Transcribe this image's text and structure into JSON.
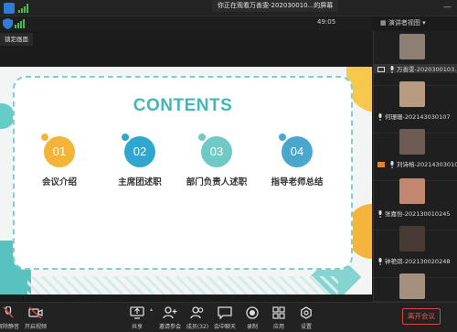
{
  "topbar": {
    "title": "你正在观看万善雯-202030010...的屏幕",
    "minimize": "—"
  },
  "meetbar": {
    "timer": "49:05",
    "view_mode": "演讲者视图"
  },
  "lock_view": "锁定画面",
  "slide": {
    "heading": "CONTENTS",
    "items": [
      {
        "num": "01",
        "label": "会议介绍",
        "color": "#f4b43a"
      },
      {
        "num": "02",
        "label": "主席团述职",
        "color": "#2fa7cf"
      },
      {
        "num": "03",
        "label": "部门负责人述职",
        "color": "#6fcac6"
      },
      {
        "num": "04",
        "label": "指导老师总结",
        "color": "#49a6cc"
      }
    ]
  },
  "participants": [
    {
      "name": "万善雯-2020300103...",
      "photo": "#8d7f73",
      "screen": true
    },
    {
      "name": "何珊珊-202143030107",
      "photo": "#b89c7f",
      "screen": false
    },
    {
      "name": "刘诗榕-20214303010...",
      "photo": "#6e5a55",
      "screen": true
    },
    {
      "name": "张嘉怡-202130010245",
      "photo": "#c1876f",
      "screen": false
    },
    {
      "name": "钟艳琪-202130020248",
      "photo": "#4a3a35",
      "screen": false
    },
    {
      "name": "",
      "photo": "#a58f7e",
      "screen": false
    }
  ],
  "toolbar": {
    "mute": "解除静音",
    "video": "开启视频",
    "share": "共享",
    "invite": "邀请参会",
    "members": "成员(32)",
    "chat": "会中聊天",
    "record": "录制",
    "apps": "应用",
    "settings": "设置",
    "leave": "离开会议"
  }
}
